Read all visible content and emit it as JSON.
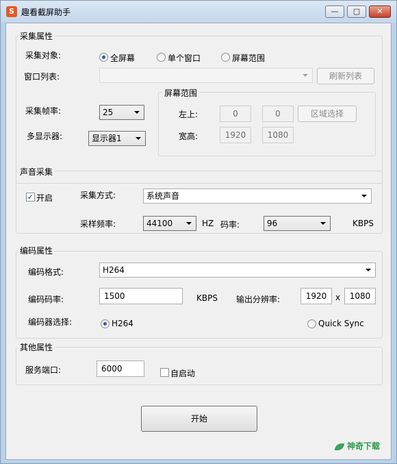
{
  "window": {
    "title": "趣看截屏助手",
    "app_icon_glyph": "S",
    "buttons": {
      "minimize": "—",
      "maximize": "▢",
      "close": "✕"
    }
  },
  "capture": {
    "group_title": "采集属性",
    "target_label": "采集对象:",
    "target_options": [
      {
        "label": "全屏幕",
        "selected": true
      },
      {
        "label": "单个窗口",
        "selected": false
      },
      {
        "label": "屏幕范围",
        "selected": false
      }
    ],
    "window_list_label": "窗口列表:",
    "window_list_value": "",
    "refresh_button": "刷新列表",
    "fps_label": "采集帧率:",
    "fps_value": "25",
    "monitor_label": "多显示器:",
    "monitor_value": "显示器1",
    "screen_range": {
      "title": "屏幕范围",
      "topleft_label": "左上:",
      "x": "0",
      "y": "0",
      "region_button": "区域选择",
      "size_label": "宽高:",
      "width": "1920",
      "height": "1080"
    }
  },
  "audio": {
    "group_title": "声音采集",
    "enable_label": "开启",
    "enable_checked": true,
    "method_label": "采集方式:",
    "method_value": "系统声音",
    "rate_label": "采样频率:",
    "rate_value": "44100",
    "rate_unit": "HZ",
    "bitrate_label": "码率:",
    "bitrate_value": "96",
    "bitrate_unit": "KBPS"
  },
  "encode": {
    "group_title": "编码属性",
    "format_label": "编码格式:",
    "format_value": "H264",
    "bitrate_label": "编码码率:",
    "bitrate_value": "1500",
    "bitrate_unit": "KBPS",
    "resolution_label": "输出分辨率:",
    "res_width": "1920",
    "res_sep": "x",
    "res_height": "1080",
    "encoder_label": "编码器选择:",
    "encoders": [
      {
        "label": "H264",
        "selected": true
      },
      {
        "label": "Quick Sync",
        "selected": false
      }
    ]
  },
  "other": {
    "group_title": "其他属性",
    "port_label": "服务端口:",
    "port_value": "6000",
    "autostart_label": "自启动",
    "autostart_checked": false
  },
  "start_button": "开始",
  "watermark": "神奇下载",
  "colors": {
    "accent": "#2b5ea8",
    "close": "#c8402a",
    "watermark": "#2e9a4a"
  }
}
